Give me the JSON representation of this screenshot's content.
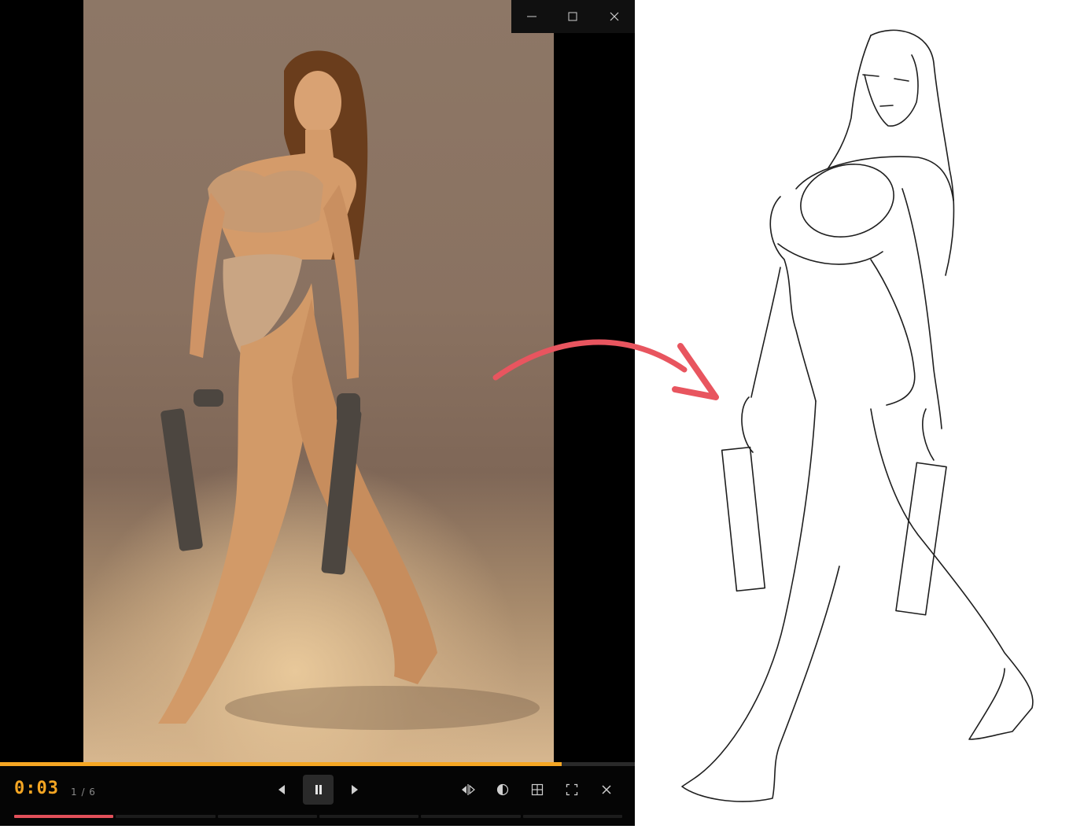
{
  "window": {
    "minimize_icon": "minimize-icon",
    "maximize_icon": "maximize-icon",
    "close_icon": "close-icon"
  },
  "player": {
    "timer": "0:03",
    "counter": "1 / 6",
    "progress_fraction": 0.885,
    "current_segment": 1,
    "segment_count": 6,
    "accent_color": "#f5a623",
    "segment_color": "#e2505a"
  },
  "controls": {
    "prev_icon": "previous-icon",
    "pause_icon": "pause-icon",
    "next_icon": "next-icon",
    "flip_icon": "flip-horizontal-icon",
    "contrast_icon": "contrast-icon",
    "grid_icon": "grid-icon",
    "fullscreen_icon": "fullscreen-icon",
    "close_icon": "close-icon"
  },
  "annotation": {
    "arrow_color": "#e8555f"
  }
}
